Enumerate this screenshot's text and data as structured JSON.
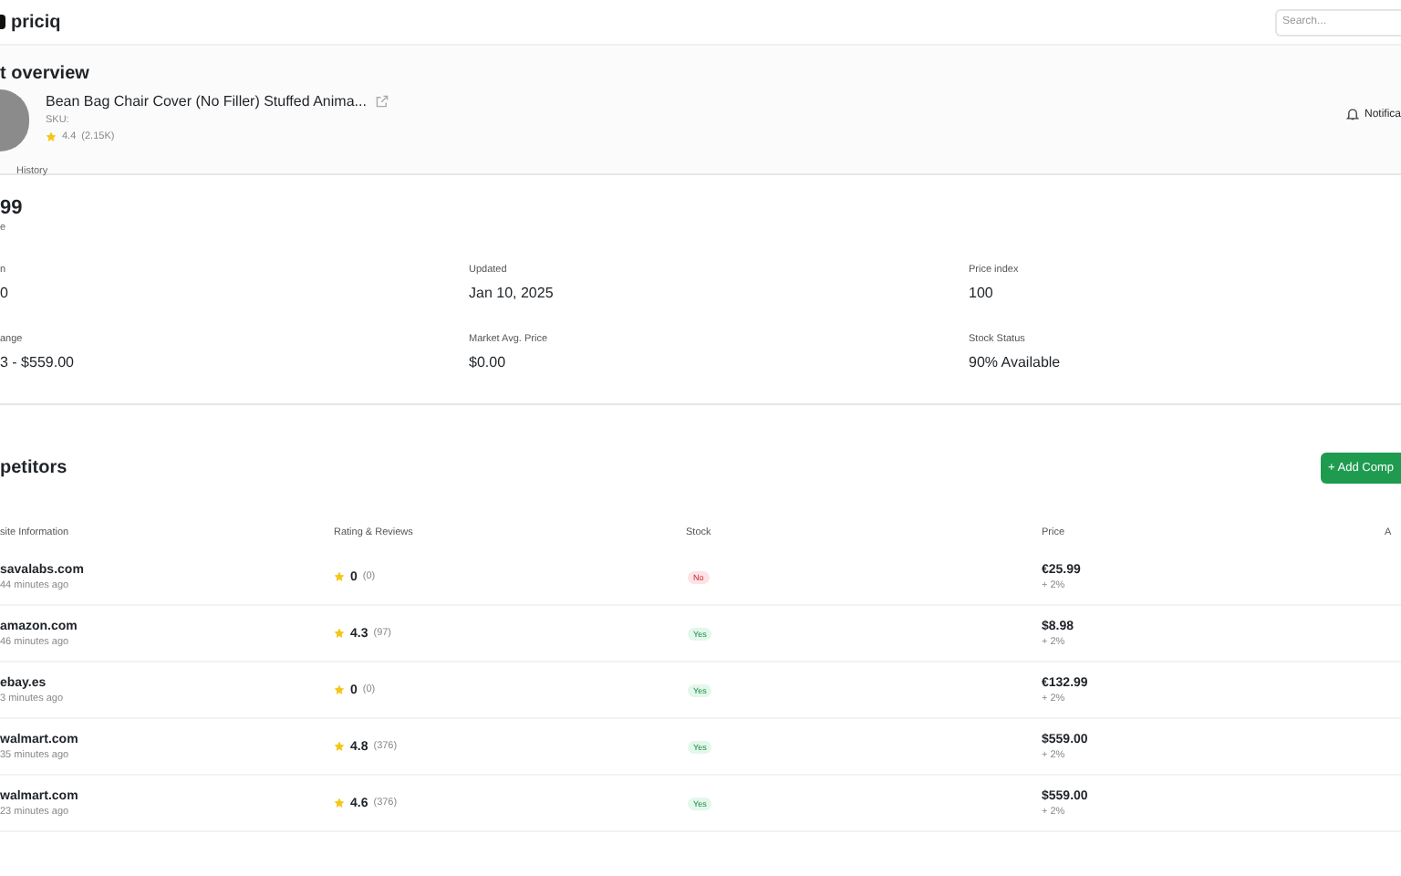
{
  "header": {
    "logo": "priciq",
    "search": {
      "placeholder": "Search..."
    }
  },
  "overview": {
    "title": "t overview",
    "product": {
      "name": "Bean Bag Chair Cover (No Filler) Stuffed Anima...",
      "sku": "SKU:",
      "rating": "4.4",
      "reviews": "(2.15K)"
    },
    "notifications": "Notifica",
    "tabs": [
      {
        "label": "History",
        "selected": false
      }
    ]
  },
  "stats": {
    "price": "99",
    "price_caption": "e",
    "items": [
      {
        "label": "n",
        "value": "0"
      },
      {
        "label": "Updated",
        "value": "Jan 10, 2025"
      },
      {
        "label": "Price index",
        "value": "100"
      },
      {
        "label": "ange",
        "value": "3 - $559.00"
      },
      {
        "label": "Market Avg. Price",
        "value": "$0.00"
      },
      {
        "label": "Stock Status",
        "value": "90% Available"
      }
    ]
  },
  "competitors": {
    "title": "petitors",
    "add_button": "+ Add Comp",
    "columns": [
      "site Information",
      "Rating & Reviews",
      "Stock",
      "Price",
      "A"
    ],
    "rows": [
      {
        "site": "savalabs.com",
        "time": "44 minutes ago",
        "rating": "0",
        "reviews": "(0)",
        "stock": "No",
        "in_stock": false,
        "price": "€25.99",
        "change": "+ 2%"
      },
      {
        "site": "amazon.com",
        "time": "46 minutes ago",
        "rating": "4.3",
        "reviews": "(97)",
        "stock": "Yes",
        "in_stock": true,
        "price": "$8.98",
        "change": "+ 2%"
      },
      {
        "site": "ebay.es",
        "time": "3 minutes ago",
        "rating": "0",
        "reviews": "(0)",
        "stock": "Yes",
        "in_stock": true,
        "price": "€132.99",
        "change": "+ 2%"
      },
      {
        "site": "walmart.com",
        "time": "35 minutes ago",
        "rating": "4.8",
        "reviews": "(376)",
        "stock": "Yes",
        "in_stock": true,
        "price": "$559.00",
        "change": "+ 2%"
      },
      {
        "site": "walmart.com",
        "time": "23 minutes ago",
        "rating": "4.6",
        "reviews": "(376)",
        "stock": "Yes",
        "in_stock": true,
        "price": "$559.00",
        "change": "+ 2%"
      }
    ]
  }
}
